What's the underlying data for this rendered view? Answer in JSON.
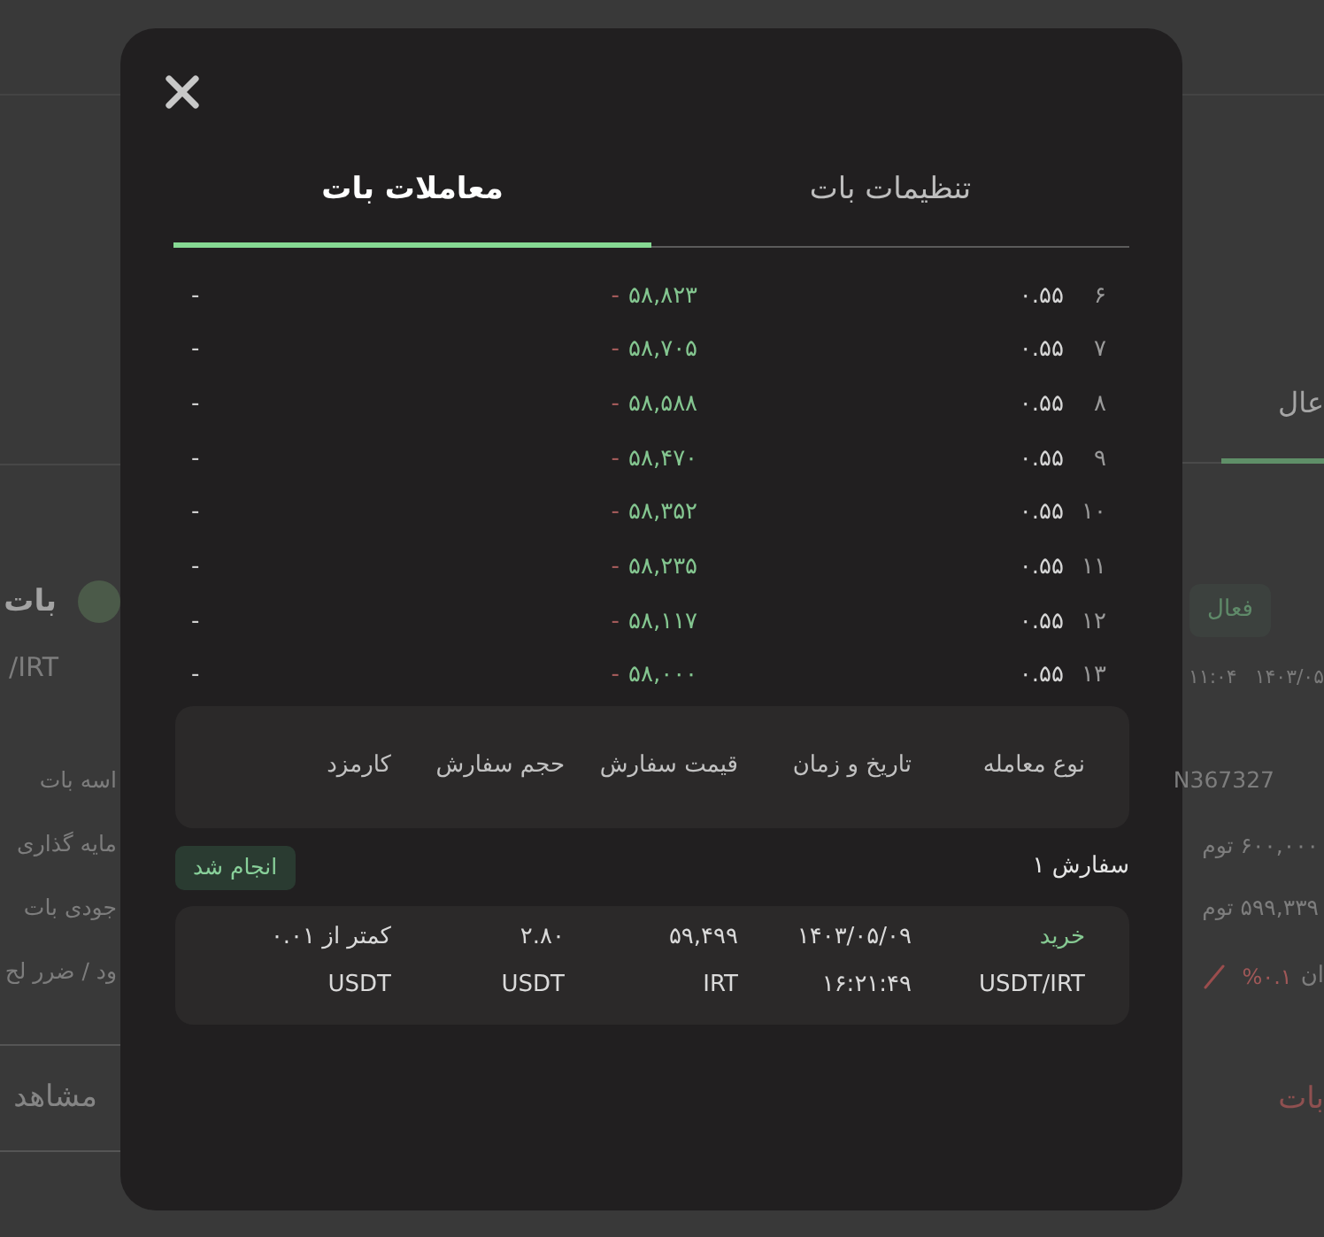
{
  "background_page": {
    "left": {
      "bot_name": "بات",
      "pair": "/IRT",
      "labels": [
        "اسه بات",
        "مایه گذاری",
        "جودی بات",
        "ود / ضرر لح"
      ],
      "view_button": "مشاهد"
    },
    "right": {
      "tab": {
        "label": "عال",
        "selected": true
      },
      "status": {
        "label": "فعال",
        "kind": "active"
      },
      "date": "۱۴۰۳/۰۵",
      "time": "۱۱:۰۴",
      "values": [
        "N367327",
        "۶۰۰,۰۰۰ توم",
        "۵۹۹,۳۳۹ توم"
      ],
      "change": {
        "label": "ان",
        "value": "%۰.۱"
      },
      "action": "بات"
    }
  },
  "modal": {
    "tabs": [
      {
        "label": "تنظیمات بات",
        "selected": false
      },
      {
        "label": "معاملات بات",
        "selected": true
      }
    ],
    "trades": [
      {
        "index": "۶",
        "amount": "۰.۵۵",
        "buy_price": "۵۸,۸۲۳",
        "sell_price": "-",
        "profit": "-"
      },
      {
        "index": "۷",
        "amount": "۰.۵۵",
        "buy_price": "۵۸,۷۰۵",
        "sell_price": "-",
        "profit": "-"
      },
      {
        "index": "۸",
        "amount": "۰.۵۵",
        "buy_price": "۵۸,۵۸۸",
        "sell_price": "-",
        "profit": "-"
      },
      {
        "index": "۹",
        "amount": "۰.۵۵",
        "buy_price": "۵۸,۴۷۰",
        "sell_price": "-",
        "profit": "-"
      },
      {
        "index": "۱۰",
        "amount": "۰.۵۵",
        "buy_price": "۵۸,۳۵۲",
        "sell_price": "-",
        "profit": "-"
      },
      {
        "index": "۱۱",
        "amount": "۰.۵۵",
        "buy_price": "۵۸,۲۳۵",
        "sell_price": "-",
        "profit": "-"
      },
      {
        "index": "۱۲",
        "amount": "۰.۵۵",
        "buy_price": "۵۸,۱۱۷",
        "sell_price": "-",
        "profit": "-"
      },
      {
        "index": "۱۳",
        "amount": "۰.۵۵",
        "buy_price": "۵۸,۰۰۰",
        "sell_price": "-",
        "profit": "-"
      }
    ],
    "order_columns": [
      "نوع معامله",
      "تاریخ و زمان",
      "قیمت سفارش",
      "حجم سفارش",
      "کارمزد"
    ],
    "order": {
      "title": "سفارش ۱",
      "status": {
        "label": "انجام شد",
        "kind": "done"
      },
      "side": {
        "label": "خرید",
        "kind": "buy"
      },
      "date": "۱۴۰۳/۰۵/۰۹",
      "price": "۵۹,۴۹۹",
      "volume": "۲.۸۰",
      "fee": "کمتر از ۰.۰۱",
      "pair": "USDT/IRT",
      "time": "۱۶:۲۱:۴۹",
      "price_unit": "IRT",
      "volume_unit": "USDT",
      "fee_unit": "USDT"
    }
  }
}
